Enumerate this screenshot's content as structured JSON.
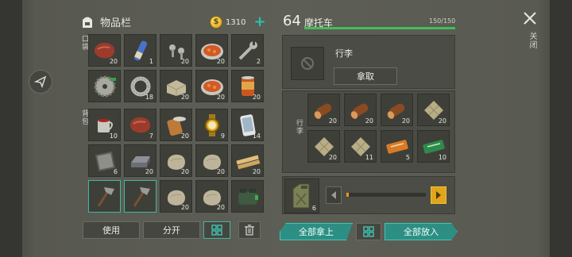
{
  "inventory": {
    "title": "物品栏",
    "coins": "1310",
    "pocket_label": "口袋",
    "backpack_label": "背包",
    "pocket_slots": [
      {
        "name": "meat-steak-icon",
        "count": "20"
      },
      {
        "name": "bandage-roll-icon",
        "count": "1"
      },
      {
        "name": "bolts-icon",
        "count": "20"
      },
      {
        "name": "stew-bowl-icon",
        "count": "20"
      },
      {
        "name": "wrench-icon",
        "count": "2"
      },
      {
        "name": "saw-blade-icon",
        "count": ""
      },
      {
        "name": "metal-ring-icon",
        "count": "18"
      },
      {
        "name": "stone-block-icon",
        "count": "20"
      },
      {
        "name": "stew-bowl-icon",
        "count": "20"
      },
      {
        "name": "canned-food-icon",
        "count": "20"
      }
    ],
    "backpack_slots": [
      {
        "name": "mug-icon",
        "count": "10"
      },
      {
        "name": "meat-steak-icon",
        "count": "7"
      },
      {
        "name": "tin-can-icon",
        "count": "20"
      },
      {
        "name": "gold-watch-icon",
        "count": "9"
      },
      {
        "name": "smartphone-icon",
        "count": "14"
      },
      {
        "name": "scrap-metal-icon",
        "count": "6"
      },
      {
        "name": "iron-ingot-icon",
        "count": "20"
      },
      {
        "name": "stone-icon",
        "count": "20"
      },
      {
        "name": "stone-icon",
        "count": "20"
      },
      {
        "name": "wood-planks-icon",
        "count": "20"
      },
      {
        "name": "stone-axe-icon",
        "count": ""
      },
      {
        "name": "stone-axe-icon",
        "count": ""
      },
      {
        "name": "stone-icon",
        "count": "20"
      },
      {
        "name": "stone-icon",
        "count": "20"
      },
      {
        "name": "military-bag-icon",
        "count": ""
      }
    ],
    "use_label": "使用",
    "split_label": "分开"
  },
  "vehicle": {
    "level": "64",
    "name": "摩托车",
    "capacity": "150/150",
    "luggage_label": "行李",
    "take_label": "拿取",
    "storage_label": "行李",
    "storage_slots": [
      {
        "name": "wood-log-icon",
        "count": "20"
      },
      {
        "name": "wood-log-icon",
        "count": "20"
      },
      {
        "name": "wood-log-icon",
        "count": "20"
      },
      {
        "name": "cloth-bundle-icon",
        "count": "20"
      },
      {
        "name": "cloth-bundle-icon",
        "count": "20"
      },
      {
        "name": "cloth-bundle-icon",
        "count": "11"
      },
      {
        "name": "coupon-orange-icon",
        "count": "5"
      },
      {
        "name": "coupon-green-icon",
        "count": "10"
      }
    ],
    "fuel_count": "6",
    "take_all_label": "全部拿上",
    "put_all_label": "全部放入"
  },
  "close_label": "关闭",
  "colors": {
    "accent": "#2d8f84",
    "bar": "#3fbf58",
    "coin": "#f2c23a"
  },
  "fuel_level": 0.02
}
